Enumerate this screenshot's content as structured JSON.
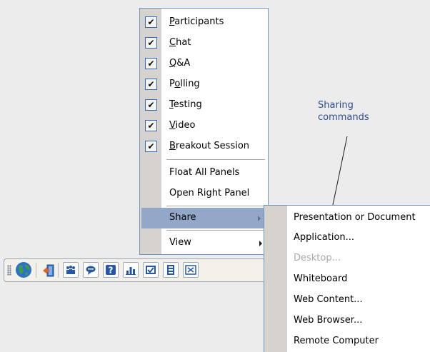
{
  "menu": {
    "items": [
      {
        "accel": "P",
        "rest": "articipants",
        "checked": true
      },
      {
        "accel": "C",
        "rest": "hat",
        "checked": true
      },
      {
        "accel": "Q",
        "rest": "&A",
        "checked": true
      },
      {
        "pre": "P",
        "accel": "o",
        "rest": "lling",
        "checked": true
      },
      {
        "accel": "T",
        "rest": "esting",
        "checked": true
      },
      {
        "accel": "V",
        "rest": "ideo",
        "checked": true
      },
      {
        "accel": "B",
        "rest": "reakout Session",
        "checked": true
      }
    ],
    "float_all_panels": "Float All Panels",
    "open_right_panel": "Open Right Panel",
    "share": "Share",
    "view": "View"
  },
  "share_menu": {
    "items": [
      {
        "label": "Presentation or Document",
        "enabled": true
      },
      {
        "label": "Application...",
        "enabled": true
      },
      {
        "label": "Desktop...",
        "enabled": false
      },
      {
        "label": "Whiteboard",
        "enabled": true
      },
      {
        "label": "Web Content...",
        "enabled": true
      },
      {
        "label": "Web Browser...",
        "enabled": true
      },
      {
        "label": "Remote Computer",
        "enabled": true
      }
    ]
  },
  "annotation": {
    "line1": "Sharing",
    "line2": "commands"
  },
  "toolbar": {
    "buttons": [
      "globe-icon",
      "exit-icon",
      "participants-icon",
      "chat-icon",
      "qa-icon",
      "polling-icon",
      "testing-icon",
      "video-icon",
      "breakout-icon"
    ]
  },
  "colors": {
    "menu_border": "#6f96c0",
    "highlight": "#93a8c8",
    "gutter": "#d6d3ce",
    "annotation": "#2f4b8e",
    "disabled_text": "#a9a9a9"
  }
}
